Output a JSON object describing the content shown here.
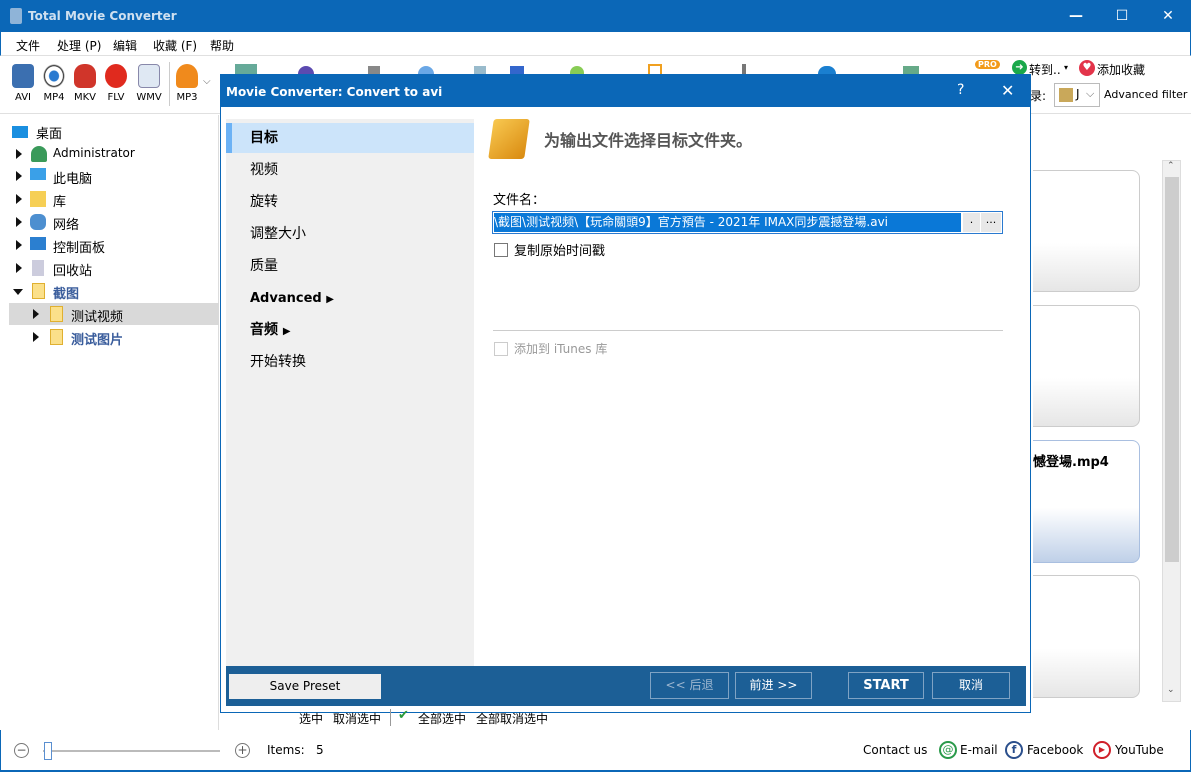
{
  "app": {
    "title": "Total Movie Converter"
  },
  "menu": [
    "文件",
    "处理 (P)",
    "编辑",
    "收藏 (F)",
    "帮助"
  ],
  "toolbar": {
    "formats": [
      "AVI",
      "MP4",
      "MKV",
      "FLV",
      "WMV",
      "MP3"
    ],
    "goto": "转到..",
    "favorite": "添加收藏",
    "filter_label": "录:",
    "filter_value": "J",
    "advanced_filter": "Advanced filter",
    "pro_badge": "PRO"
  },
  "tree": {
    "root": "桌面",
    "items": [
      "Administrator",
      "此电脑",
      "库",
      "网络",
      "控制面板",
      "回收站",
      "截图"
    ],
    "children": [
      "测试视频",
      "测试图片"
    ]
  },
  "dialog": {
    "title": "Movie Converter:  Convert to avi",
    "help": "?",
    "nav": [
      "目标",
      "视频",
      "旋转",
      "调整大小",
      "质量",
      "Advanced",
      "音频",
      "开始转换"
    ],
    "heading": "为输出文件选择目标文件夹。",
    "filename_label": "文件名：",
    "filename_value": "\\截图\\测试视频\\【玩命關頭9】官方預告 - 2021年 IMAX同步震撼登場.avi",
    "dot_btn": ".",
    "browse_btn": "...",
    "copy_timestamp": "复制原始时间戳",
    "add_itunes": "添加到 iTunes 库",
    "save_preset": "Save Preset",
    "back": "<< 后退",
    "next": "前进 >>",
    "start": "START",
    "cancel": "取消"
  },
  "files": {
    "visible_name": "憾登場.mp4"
  },
  "selection": {
    "select": "选中",
    "deselect": "取消选中",
    "select_all": "全部选中",
    "deselect_all": "全部取消选中"
  },
  "status": {
    "items_label": "Items:",
    "items_count": "5",
    "contact": "Contact us",
    "email": "E-mail",
    "facebook": "Facebook",
    "youtube": "YouTube"
  }
}
